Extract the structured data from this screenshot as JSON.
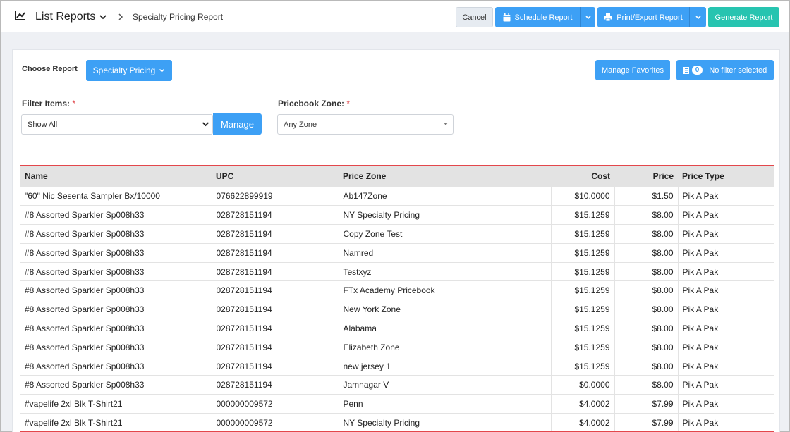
{
  "header": {
    "title": "List Reports",
    "breadcrumb": "Specialty Pricing Report",
    "buttons": {
      "cancel": "Cancel",
      "schedule": "Schedule Report",
      "print": "Print/Export Report",
      "generate": "Generate Report"
    }
  },
  "controls": {
    "choose_label": "Choose Report",
    "report_select": "Specialty Pricing",
    "manage_favorites": "Manage Favorites",
    "filter_count": "0",
    "filter_status": "No filter selected",
    "filter_items_label": "Filter Items:",
    "filter_items_value": "Show All",
    "manage": "Manage",
    "zone_label": "Pricebook Zone:",
    "zone_value": "Any Zone",
    "required_mark": "*"
  },
  "table": {
    "columns": [
      "Name",
      "UPC",
      "Price Zone",
      "Cost",
      "Price",
      "Price Type"
    ],
    "rows": [
      [
        "\"60\" Nic Sesenta Sampler Bx/10000",
        "076622899919",
        "Ab147Zone",
        "$10.0000",
        "$1.50",
        "Pik A Pak"
      ],
      [
        "#8 Assorted Sparkler Sp008h33",
        "028728151194",
        "NY Specialty Pricing",
        "$15.1259",
        "$8.00",
        "Pik A Pak"
      ],
      [
        "#8 Assorted Sparkler Sp008h33",
        "028728151194",
        "Copy Zone Test",
        "$15.1259",
        "$8.00",
        "Pik A Pak"
      ],
      [
        "#8 Assorted Sparkler Sp008h33",
        "028728151194",
        "Namred",
        "$15.1259",
        "$8.00",
        "Pik A Pak"
      ],
      [
        "#8 Assorted Sparkler Sp008h33",
        "028728151194",
        "Testxyz",
        "$15.1259",
        "$8.00",
        "Pik A Pak"
      ],
      [
        "#8 Assorted Sparkler Sp008h33",
        "028728151194",
        "FTx Academy Pricebook",
        "$15.1259",
        "$8.00",
        "Pik A Pak"
      ],
      [
        "#8 Assorted Sparkler Sp008h33",
        "028728151194",
        "New York Zone",
        "$15.1259",
        "$8.00",
        "Pik A Pak"
      ],
      [
        "#8 Assorted Sparkler Sp008h33",
        "028728151194",
        "Alabama",
        "$15.1259",
        "$8.00",
        "Pik A Pak"
      ],
      [
        "#8 Assorted Sparkler Sp008h33",
        "028728151194",
        "Elizabeth Zone",
        "$15.1259",
        "$8.00",
        "Pik A Pak"
      ],
      [
        "#8 Assorted Sparkler Sp008h33",
        "028728151194",
        "new jersey 1",
        "$15.1259",
        "$8.00",
        "Pik A Pak"
      ],
      [
        "#8 Assorted Sparkler Sp008h33",
        "028728151194",
        "Jamnagar V",
        "$0.0000",
        "$8.00",
        "Pik A Pak"
      ],
      [
        "#vapelife 2xl Blk T-Shirt21",
        "000000009572",
        "Penn",
        "$4.0002",
        "$7.99",
        "Pik A Pak"
      ],
      [
        "#vapelife 2xl Blk T-Shirt21",
        "000000009572",
        "NY Specialty Pricing",
        "$4.0002",
        "$7.99",
        "Pik A Pak"
      ]
    ]
  },
  "colors": {
    "primary": "#3da0f5",
    "generate": "#27c4b0",
    "highlight_border": "#e3474b"
  },
  "icons": {
    "title": "line-chart-icon",
    "calendar": "calendar-icon",
    "print": "printer-icon",
    "filter": "document-icon"
  }
}
